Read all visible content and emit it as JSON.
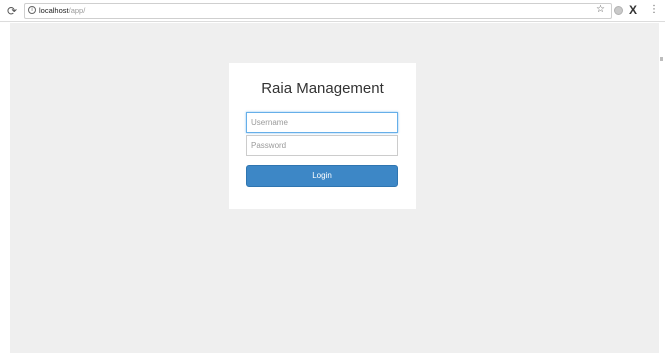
{
  "browser": {
    "url_host": "localhost",
    "url_path": "/app/",
    "icons": {
      "reload": "reload-icon",
      "info": "info-icon",
      "bookmark": "star-icon",
      "extension_1": "extension-icon",
      "extension_2": "x-extension-icon",
      "menu": "kebab-menu-icon"
    }
  },
  "login": {
    "title": "Raia Management",
    "username_placeholder": "Username",
    "password_placeholder": "Password",
    "button_label": "Login"
  },
  "colors": {
    "page_background": "#efefef",
    "card_background": "#ffffff",
    "button_primary": "#3d87c6",
    "input_focus": "#66afe9"
  }
}
